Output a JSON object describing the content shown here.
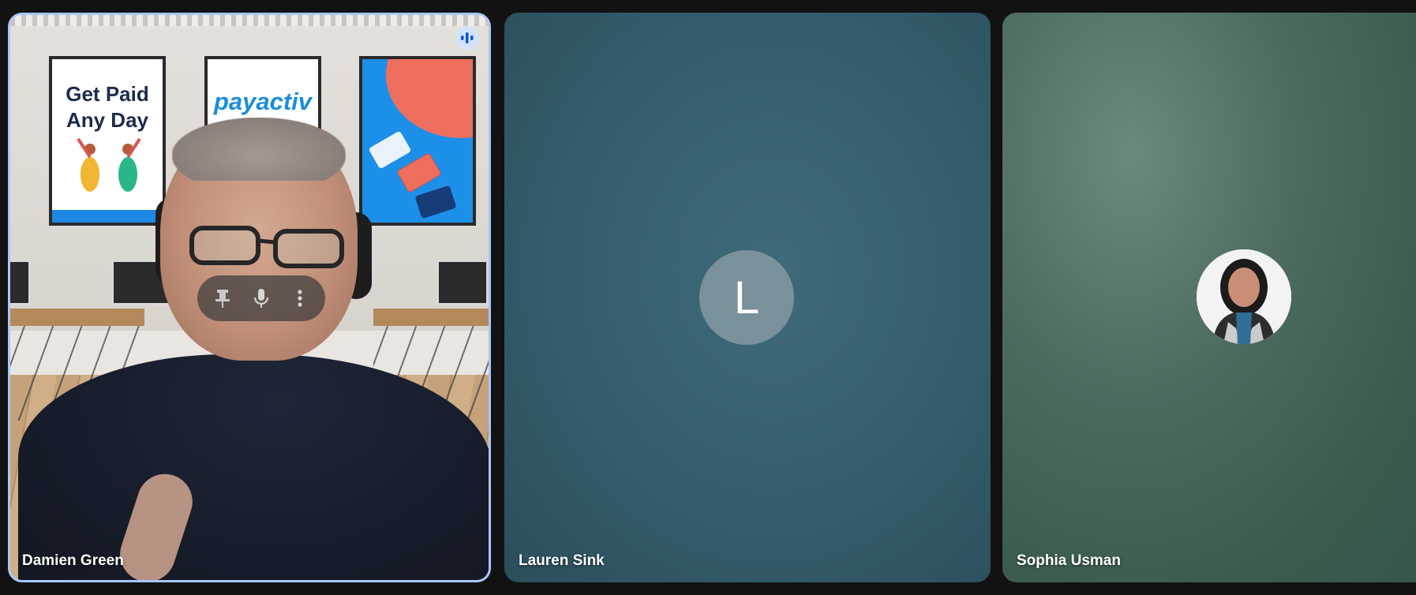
{
  "participants": [
    {
      "name": "Damien Green",
      "speaking": true,
      "video_on": true
    },
    {
      "name": "Lauren Sink",
      "avatar_initial": "L",
      "video_on": false
    },
    {
      "name": "Sophia Usman",
      "avatar_type": "photo",
      "video_on": false
    }
  ],
  "background_posters": {
    "poster_1_line_1": "Get Paid",
    "poster_1_line_2": "Any Day",
    "poster_2_brand": "payactiv"
  },
  "tile_controls": {
    "icons": [
      "pin-icon",
      "microphone-icon",
      "more-vert-icon"
    ]
  },
  "colors": {
    "active_border": "#a8c7fa",
    "speaking_badge": "#d3e3fd",
    "speaking_icon": "#0b57d0",
    "lauren_avatar": "#7a919c"
  }
}
